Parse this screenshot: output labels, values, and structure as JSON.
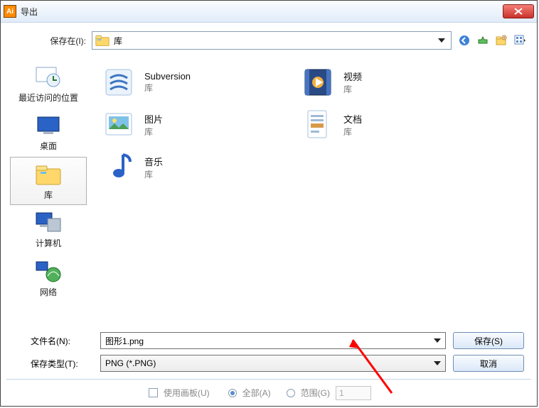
{
  "titlebar": {
    "title": "导出",
    "appIcon": "Ai"
  },
  "toolbar": {
    "saveInLabel": "保存在(I):",
    "locationText": "库",
    "navIcons": [
      "back-icon",
      "up-icon",
      "new-folder-icon",
      "views-icon"
    ]
  },
  "places": [
    {
      "id": "recent",
      "label": "最近访问的位置"
    },
    {
      "id": "desktop",
      "label": "桌面"
    },
    {
      "id": "libraries",
      "label": "库",
      "active": true
    },
    {
      "id": "computer",
      "label": "计算机"
    },
    {
      "id": "network",
      "label": "网络"
    }
  ],
  "files": [
    {
      "id": "subversion",
      "name": "Subversion",
      "type": "库"
    },
    {
      "id": "videos",
      "name": "视频",
      "type": "库"
    },
    {
      "id": "pictures",
      "name": "图片",
      "type": "库"
    },
    {
      "id": "documents",
      "name": "文档",
      "type": "库"
    },
    {
      "id": "music",
      "name": "音乐",
      "type": "库"
    }
  ],
  "form": {
    "filenameLabel": "文件名(N):",
    "filetypeLabel": "保存类型(T):",
    "filenameValue": "图形1.png",
    "filetypeValue": "PNG (*.PNG)",
    "saveButton": "保存(S)",
    "cancelButton": "取消"
  },
  "footer": {
    "artboardLabel": "使用画板(U)",
    "allLabel": "全部(A)",
    "rangeLabel": "范围(G)",
    "rangeValue": "1"
  }
}
